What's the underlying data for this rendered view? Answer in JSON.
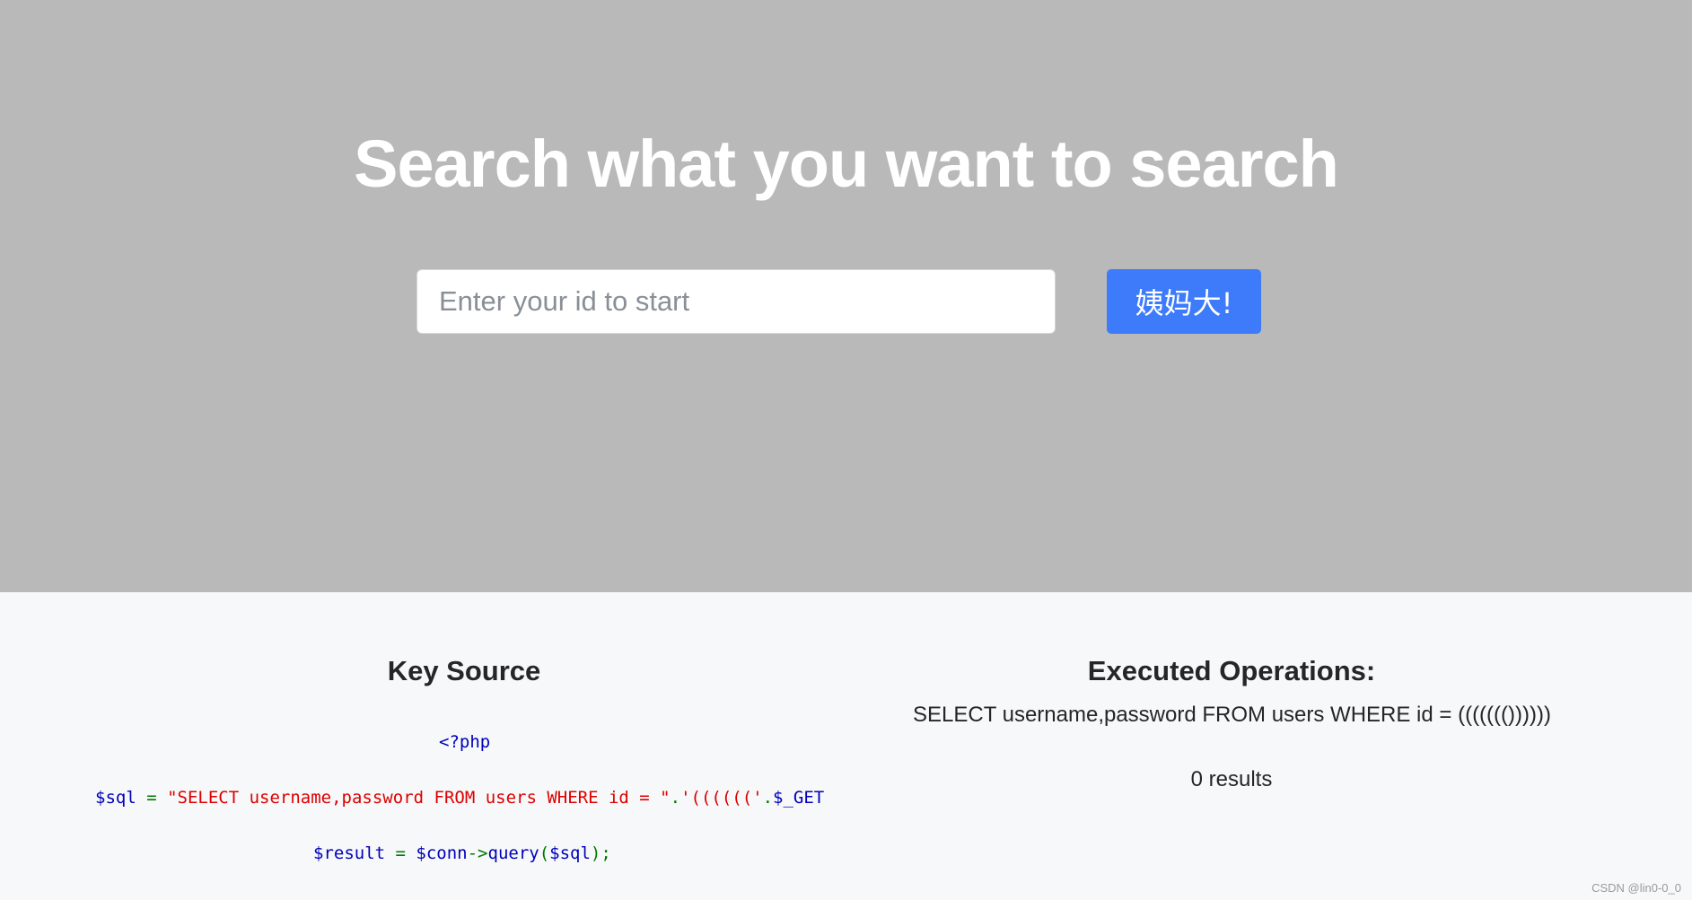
{
  "hero": {
    "title": "Search what you want to search",
    "search_placeholder": "Enter your id to start",
    "search_value": "",
    "button_label": "姨妈大!"
  },
  "key_source": {
    "heading": "Key Source",
    "line1": "<?php",
    "line2": {
      "var": "$sql",
      "eq": " = ",
      "str": "\"SELECT username,password FROM users WHERE id = \"",
      "dot1": ".",
      "str2": "'(((((('",
      "dot2": ".",
      "get": "$_GET"
    },
    "line3": {
      "var": "$result",
      "eq": " = ",
      "conn": "$conn",
      "arrow": "->",
      "method": "query",
      "paren_open": "(",
      "arg": "$sql",
      "paren_close": ");"
    }
  },
  "executed": {
    "heading": "Executed Operations:",
    "query": "SELECT username,password FROM users WHERE id = ((((((())))))",
    "results": "0 results"
  },
  "watermark": "CSDN @lin0-0_0",
  "colors": {
    "hero_bg": "#b9b9b9",
    "button_bg": "#3d7bfb",
    "php_variable": "#0000bb",
    "php_string": "#dd0000",
    "php_operator": "#007700"
  }
}
